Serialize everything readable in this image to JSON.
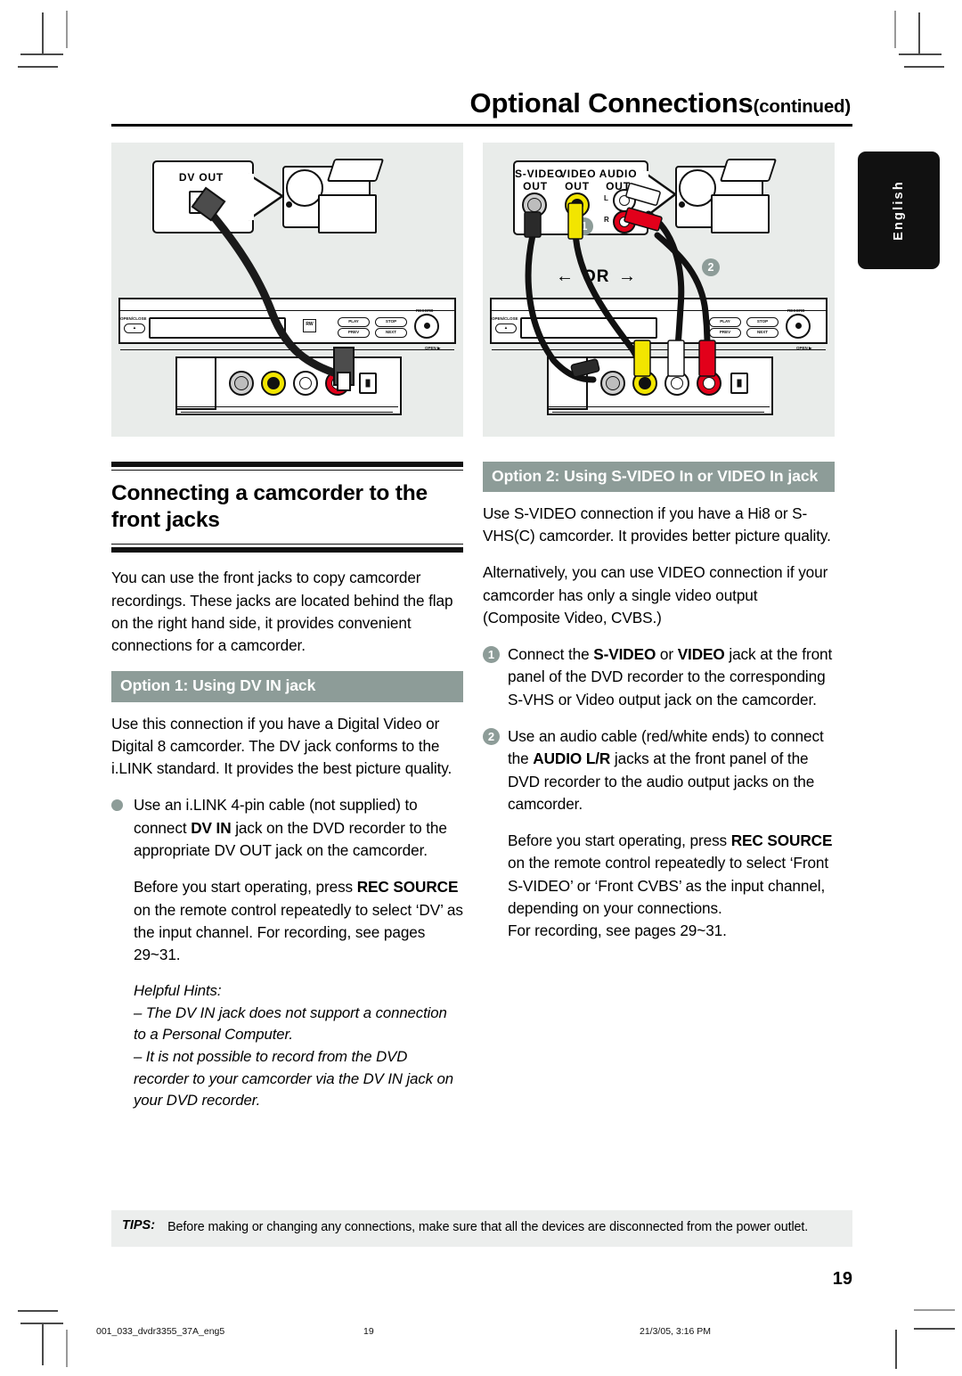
{
  "header": {
    "title": "Optional Connections",
    "continued": "(continued)"
  },
  "lang_tab": {
    "label": "English"
  },
  "illustration_left": {
    "name": "dv-in-connection-diagram",
    "callout_label": "DV OUT",
    "deck_buttons": [
      "PLAY",
      "STOP",
      "PREV",
      "NEXT"
    ],
    "deck_labels": {
      "open_close": "OPEN/CLOSE",
      "record": "RECORD",
      "open_flap": "OPEN"
    }
  },
  "illustration_right": {
    "name": "s-video-video-audio-connection-diagram",
    "callout_labels": [
      "S-VIDEO\nOUT",
      "VIDEO\nOUT",
      "AUDIO\nOUT"
    ],
    "s_video_line1": "S-VIDEO",
    "s_video_line2": "OUT",
    "video_line1": "VIDEO",
    "video_line2": "OUT",
    "audio_line1": "AUDIO",
    "audio_line2": "OUT",
    "channel_l": "L",
    "channel_r": "R",
    "or_label": "OR",
    "arrow_left": "←",
    "arrow_right": "→",
    "badge_1": "1",
    "badge_2": "2",
    "deck_buttons": [
      "PLAY",
      "STOP",
      "PREV",
      "NEXT"
    ],
    "deck_labels": {
      "open_close": "OPEN/CLOSE",
      "record": "RECORD",
      "open_flap": "OPEN"
    }
  },
  "left_column": {
    "section_title": "Connecting a camcorder to the front jacks",
    "intro": "You can use the front jacks to copy camcorder recordings. These jacks are located behind the flap on the right hand side, it provides convenient connections for a camcorder.",
    "option_heading": "Option 1: Using DV IN jack",
    "para1_a": "Use this connection if you have a Digital Video or Digital 8 camcorder. The DV jack conforms to the i.LINK standard.  It provides the best picture quality.",
    "bullet_pre": "Use an i.LINK 4-pin cable (not supplied) to connect ",
    "bullet_bold": "DV IN",
    "bullet_post": " jack on the DVD recorder to the appropriate DV OUT jack on the camcorder.",
    "para2_pre": "Before you start operating, press ",
    "para2_bold": "REC SOURCE",
    "para2_post": " on the remote control repeatedly to select ‘DV’ as the input channel.  For recording, see pages 29~31.",
    "hints_title": "Helpful Hints:",
    "hint1": "–  The DV IN jack does not support a connection to a Personal Computer.",
    "hint2": "–  It is not possible to record from the DVD recorder to your camcorder via the DV IN jack on your DVD recorder."
  },
  "right_column": {
    "option_heading": "Option 2: Using S-VIDEO In or VIDEO In jack",
    "para1": "Use S-VIDEO connection if you have a Hi8 or S-VHS(C) camcorder.  It provides better picture quality.",
    "para2": "Alternatively, you can use VIDEO connection if your camcorder has only a single video output (Composite Video, CVBS.)",
    "step1_num": "1",
    "step1_pre": "Connect the ",
    "step1_bold1": "S-VIDEO",
    "step1_mid": " or ",
    "step1_bold2": "VIDEO",
    "step1_post": " jack at the front panel of the DVD recorder to the corresponding S-VHS or Video output jack on the camcorder.",
    "step2_num": "2",
    "step2_pre": "Use an audio cable (red/white ends) to connect the ",
    "step2_bold": "AUDIO L/R",
    "step2_post": " jacks at the front panel of the DVD recorder to the audio output jacks on the camcorder.",
    "para3_pre": "Before you start operating, press ",
    "para3_bold": "REC SOURCE",
    "para3_post": " on the remote control repeatedly to select ‘Front S-VIDEO’ or ‘Front CVBS’ as the input channel, depending on your connections.",
    "para4": "For recording, see pages 29~31."
  },
  "tips": {
    "label": "TIPS:",
    "text": "Before making or changing any connections, make sure that all the devices are disconnected from the power outlet."
  },
  "page_number": "19",
  "printer_footer": {
    "file": "001_033_dvdr3355_37A_eng5",
    "page": "19",
    "date": "21/3/05, 3:16 PM"
  },
  "colors": {
    "accent_band": "#8d9c98",
    "illustration_bg": "#e9ecea",
    "tips_bg": "#eceeed",
    "jack_yellow": "#f2e500",
    "jack_red": "#e2001a",
    "jack_white": "#ffffff",
    "lang_tab_bg": "#111111"
  }
}
